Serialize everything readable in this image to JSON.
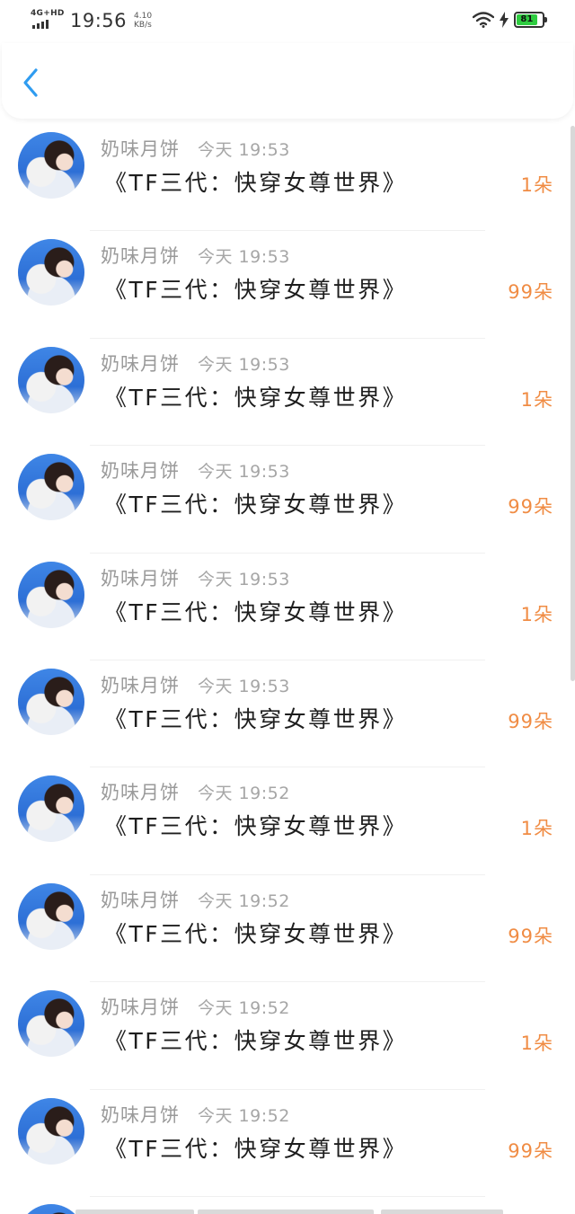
{
  "status_bar": {
    "network": "4G+HD",
    "time": "19:56",
    "speed_value": "4.10",
    "speed_unit": "KB/s",
    "battery": "81",
    "icons": [
      "signal-icon",
      "wifi-icon",
      "charging-icon",
      "battery-icon"
    ]
  },
  "header": {
    "back_icon": "chevron-left-icon"
  },
  "colors": {
    "accent": "#2f9cf0",
    "amount": "#f08c44",
    "author": "#9a9a9a"
  },
  "records": [
    {
      "author": "奶味月饼",
      "time": "今天 19:53",
      "title": "《TF三代：快穿女尊世界》",
      "amount": "1朵"
    },
    {
      "author": "奶味月饼",
      "time": "今天 19:53",
      "title": "《TF三代：快穿女尊世界》",
      "amount": "99朵"
    },
    {
      "author": "奶味月饼",
      "time": "今天 19:53",
      "title": "《TF三代：快穿女尊世界》",
      "amount": "1朵"
    },
    {
      "author": "奶味月饼",
      "time": "今天 19:53",
      "title": "《TF三代：快穿女尊世界》",
      "amount": "99朵"
    },
    {
      "author": "奶味月饼",
      "time": "今天 19:53",
      "title": "《TF三代：快穿女尊世界》",
      "amount": "1朵"
    },
    {
      "author": "奶味月饼",
      "time": "今天 19:53",
      "title": "《TF三代：快穿女尊世界》",
      "amount": "99朵"
    },
    {
      "author": "奶味月饼",
      "time": "今天 19:52",
      "title": "《TF三代：快穿女尊世界》",
      "amount": "1朵"
    },
    {
      "author": "奶味月饼",
      "time": "今天 19:52",
      "title": "《TF三代：快穿女尊世界》",
      "amount": "99朵"
    },
    {
      "author": "奶味月饼",
      "time": "今天 19:52",
      "title": "《TF三代：快穿女尊世界》",
      "amount": "1朵"
    },
    {
      "author": "奶味月饼",
      "time": "今天 19:52",
      "title": "《TF三代：快穿女尊世界》",
      "amount": "99朵"
    }
  ]
}
